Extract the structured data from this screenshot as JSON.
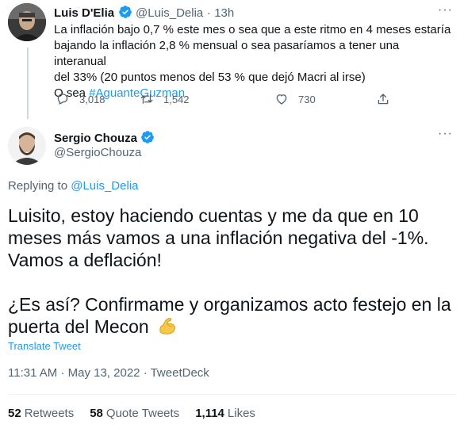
{
  "parent_tweet": {
    "name": "Luis D'Elia",
    "handle": "@Luis_Delia",
    "separator": "·",
    "time": "13h",
    "text_line1": "La inflación bajo 0,7 % este mes o sea que a este ritmo en 4 meses estaría",
    "text_line2": "bajando la inflación 2,8 % mensual o sea pasaríamos a tener una interanual",
    "text_line3": "del 33% (20 puntos menos del 53 % que dejó Macri al irse)",
    "text_prefix": "O sea ",
    "hashtag": "#AguanteGuzman",
    "replies": "3,018",
    "retweets": "1,542",
    "likes": "730",
    "more": "···"
  },
  "main_tweet": {
    "name": "Sergio Chouza",
    "handle": "@SergioChouza",
    "more": "···",
    "replying_prefix": "Replying to ",
    "replying_handle": "@Luis_Delia",
    "line1": "Luisito, estoy haciendo cuentas y me da que en 10",
    "line2": "meses más vamos a una inflación negativa del -1%.",
    "line3": "Vamos a deflación!",
    "line4": "¿Es así? Confirmame y organizamos acto festejo en la",
    "line5": "puerta del Mecon",
    "translate": "Translate Tweet",
    "time": "11:31 AM",
    "date": "May 13, 2022",
    "source": "TweetDeck",
    "separator": "·",
    "retweets_count": "52",
    "retweets_label": "Retweets",
    "quotes_count": "58",
    "quotes_label": "Quote Tweets",
    "likes_count": "1,114",
    "likes_label": "Likes"
  },
  "colors": {
    "accent": "#1d9bf0",
    "secondary_text": "#536471",
    "text": "#0f1419",
    "divider": "#eff3f4",
    "thread_line": "#cfd9de"
  },
  "icons": {
    "reply": "reply-icon",
    "retweet": "retweet-icon",
    "like": "heart-icon",
    "share": "share-icon",
    "verified": "verified-badge-icon",
    "flexed_biceps": "flexed-biceps-emoji"
  }
}
